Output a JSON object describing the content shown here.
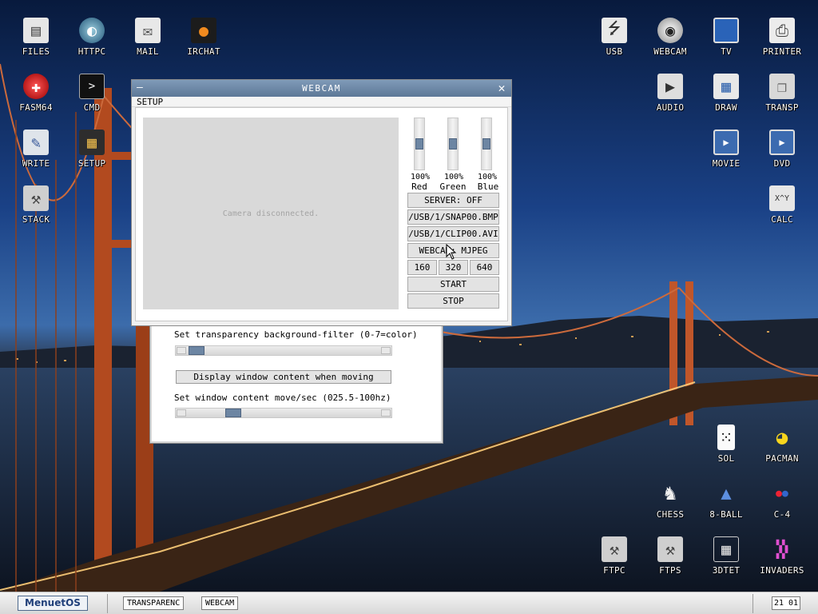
{
  "desktop": {
    "left_icons": [
      {
        "label": "FILES",
        "icon": "files-icon"
      },
      {
        "label": "HTTPC",
        "icon": "globe-icon"
      },
      {
        "label": "MAIL",
        "icon": "mail-icon"
      },
      {
        "label": "IRCHAT",
        "icon": "chat-icon"
      },
      {
        "label": "FASM64",
        "icon": "fasm-icon"
      },
      {
        "label": "CMD",
        "icon": "terminal-icon"
      },
      {
        "label": "WRITE",
        "icon": "write-icon"
      },
      {
        "label": "SETUP",
        "icon": "chip-icon"
      },
      {
        "label": "STACK",
        "icon": "tools-icon"
      }
    ],
    "right_icons": [
      {
        "label": "USB",
        "icon": "usb-icon"
      },
      {
        "label": "WEBCAM",
        "icon": "webcam-icon"
      },
      {
        "label": "TV",
        "icon": "tv-icon"
      },
      {
        "label": "PRINTER",
        "icon": "printer-icon"
      },
      {
        "label": "AUDIO",
        "icon": "play-icon"
      },
      {
        "label": "DRAW",
        "icon": "draw-icon"
      },
      {
        "label": "TRANSP",
        "icon": "transparency-icon"
      },
      {
        "label": "MOVIE",
        "icon": "movie-icon"
      },
      {
        "label": "DVD",
        "icon": "dvd-icon"
      },
      {
        "label": "CALC",
        "icon": "calc-icon",
        "glyph": "X^Y"
      },
      {
        "label": "SOL",
        "icon": "card-icon"
      },
      {
        "label": "PACMAN",
        "icon": "pacman-icon"
      },
      {
        "label": "CHESS",
        "icon": "chess-knight-icon"
      },
      {
        "label": "8-BALL",
        "icon": "billiard-icon"
      },
      {
        "label": "C-4",
        "icon": "connect4-icon"
      },
      {
        "label": "FTPC",
        "icon": "tools-icon"
      },
      {
        "label": "FTPS",
        "icon": "tools-icon"
      },
      {
        "label": "3DTET",
        "icon": "grid-icon"
      },
      {
        "label": "INVADERS",
        "icon": "invaders-icon"
      }
    ]
  },
  "transparency_window": {
    "filter_label": "Set transparency background-filter (0-7=color)",
    "filter_value": 1,
    "display_button": "Display window content when moving",
    "move_label": "Set window content move/sec (025.5-100hz)",
    "move_value_fraction": 0.3
  },
  "webcam_window": {
    "title": "WEBCAM",
    "menu": "SETUP",
    "camera_status": "Camera disconnected.",
    "sliders": [
      {
        "pct": "100%",
        "name": "Red"
      },
      {
        "pct": "100%",
        "name": "Green"
      },
      {
        "pct": "100%",
        "name": "Blue"
      }
    ],
    "buttons": {
      "server": "SERVER: OFF",
      "snap": "/USB/1/SNAP00.BMP",
      "clip": "/USB/1/CLIP00.AVI",
      "format": "WEBCAM: MJPEG",
      "res_160": "160",
      "res_320": "320",
      "res_640": "640",
      "start": "START",
      "stop": "STOP"
    }
  },
  "taskbar": {
    "start_label": "MenuetOS",
    "tasks": [
      "TRANSPARENC",
      "WEBCAM"
    ],
    "clock": "21 01"
  },
  "colors": {
    "title_bar": "#6b86a5",
    "slider_knob": "#6d86a3"
  }
}
